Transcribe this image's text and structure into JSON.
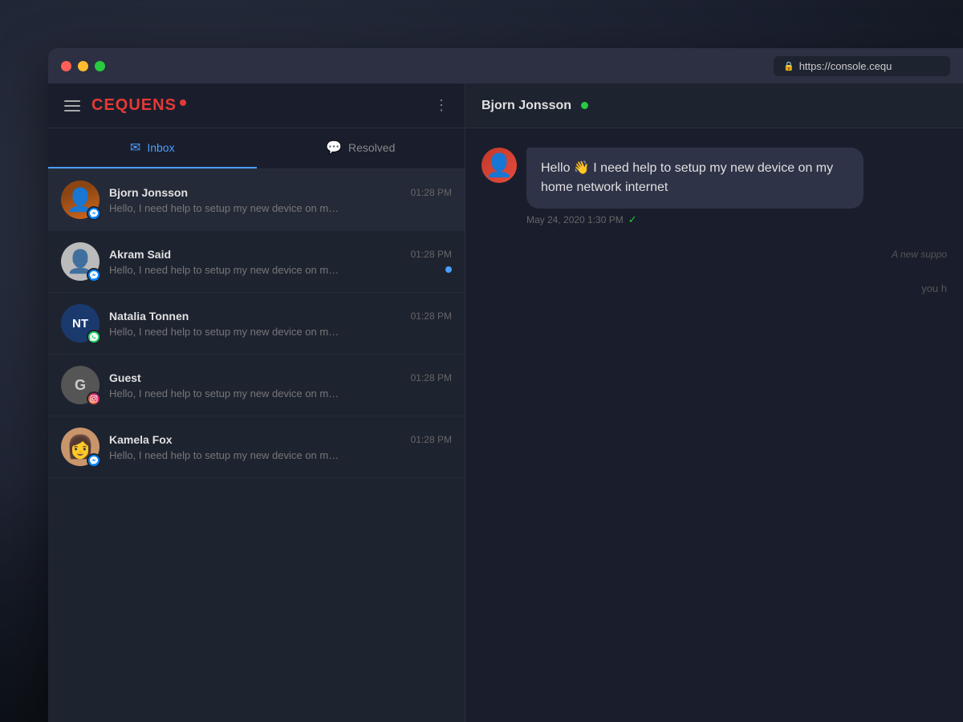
{
  "browser": {
    "address": "https://console.cequ",
    "lock_icon": "🔒"
  },
  "app": {
    "brand": "CEQUENS",
    "brand_dot": "•"
  },
  "sidebar": {
    "tabs": [
      {
        "id": "inbox",
        "label": "Inbox",
        "icon": "✉",
        "active": true
      },
      {
        "id": "resolved",
        "label": "Resolved",
        "icon": "💬",
        "active": false
      }
    ],
    "conversations": [
      {
        "id": 1,
        "name": "Bjorn Jonsson",
        "time": "01:28 PM",
        "preview": "Hello, I need help to setup my new device on my home network...",
        "platform": "messenger",
        "avatar_type": "person",
        "avatar_color": "#c0392b",
        "unread": false
      },
      {
        "id": 2,
        "name": "Akram Said",
        "time": "01:28 PM",
        "preview": "Hello, I need help to setup my new device on my home network...",
        "platform": "messenger",
        "avatar_type": "person",
        "avatar_color": "#bbb",
        "unread": true
      },
      {
        "id": 3,
        "name": "Natalia Tonnen",
        "time": "01:28 PM",
        "preview": "Hello, I need help to setup my new device on my home network...",
        "platform": "whatsapp",
        "avatar_type": "initials",
        "initials": "NT",
        "avatar_color": "#1a3a6e",
        "unread": false
      },
      {
        "id": 4,
        "name": "Guest",
        "time": "01:28 PM",
        "preview": "Hello, I need help to setup my new device on my home network...",
        "platform": "instagram",
        "avatar_type": "initials",
        "initials": "G",
        "avatar_color": "#555",
        "unread": false
      },
      {
        "id": 5,
        "name": "Kamela Fox",
        "time": "01:28 PM",
        "preview": "Hello, I need help to setup my new device on my home network...",
        "platform": "messenger",
        "avatar_type": "person",
        "avatar_color": "#d4b5a0",
        "unread": false
      }
    ]
  },
  "chat": {
    "contact_name": "Bjorn Jonsson",
    "online_status": "online",
    "messages": [
      {
        "id": 1,
        "sender": "Bjorn Jonsson",
        "text": "Hello 👋 I need help to setup my new device on my home network internet",
        "time": "May 24, 2020  1:30 PM",
        "delivered": true
      }
    ],
    "system_message": "A new suppo",
    "you_text": "you h"
  }
}
